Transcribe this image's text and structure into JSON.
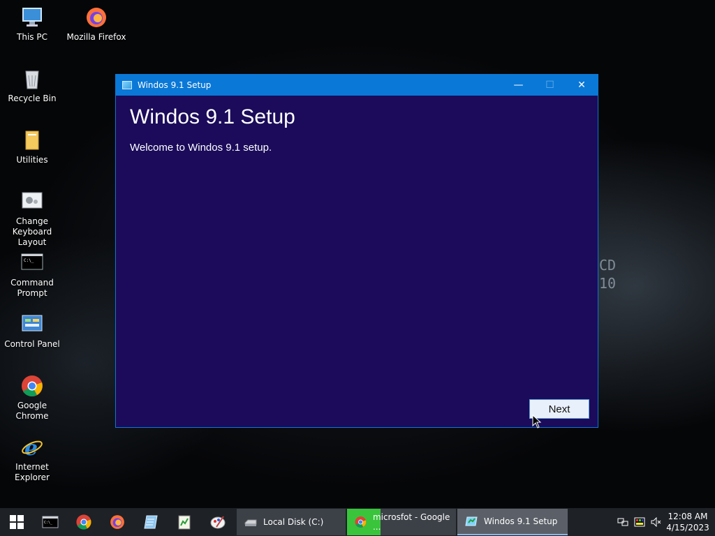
{
  "desktop": {
    "icons": [
      {
        "label": "This PC",
        "icon": "computer-icon"
      },
      {
        "label": "Mozilla Firefox",
        "icon": "firefox-icon"
      },
      {
        "label": "Recycle Bin",
        "icon": "recycle-bin-icon"
      },
      {
        "label": "Utilities",
        "icon": "folder-icon"
      },
      {
        "label": "Change Keyboard Layout",
        "icon": "keyboard-settings-icon"
      },
      {
        "label": "Command Prompt",
        "icon": "command-prompt-icon"
      },
      {
        "label": "Control Panel",
        "icon": "control-panel-icon"
      },
      {
        "label": "Google Chrome",
        "icon": "chrome-icon"
      },
      {
        "label": "Internet Explorer",
        "icon": "internet-explorer-icon"
      }
    ],
    "wallpaper_text": [
      "CD",
      "10"
    ]
  },
  "window": {
    "title": "Windos 9.1 Setup",
    "heading": "Windos 9.1 Setup",
    "welcome": "Welcome to Windos 9.1 setup.",
    "next_label": "Next",
    "minimize_glyph": "—",
    "maximize_glyph": "☐",
    "close_glyph": "✕",
    "colors": {
      "titlebar": "#0a78d7",
      "body": "#1b0b5a"
    }
  },
  "taskbar": {
    "pinned": [
      "start-icon",
      "command-prompt-icon",
      "chrome-icon",
      "firefox-icon",
      "notepad-icon",
      "spreadsheet-icon",
      "paint-icon"
    ],
    "tasks": [
      {
        "label": "Local Disk (C:)",
        "icon": "drive-icon"
      },
      {
        "label": "microsfot - Google ...",
        "icon": "chrome-icon"
      },
      {
        "label": "Windos 9.1 Setup",
        "icon": "setup-icon"
      }
    ],
    "clock": {
      "time": "12:08 AM",
      "date": "4/15/2023"
    }
  }
}
